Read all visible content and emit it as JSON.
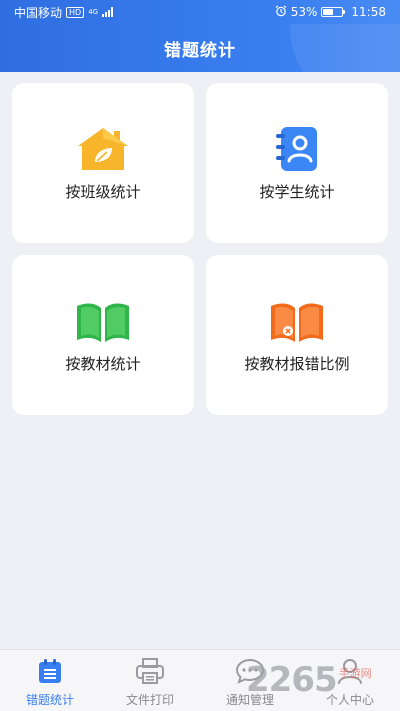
{
  "status_bar": {
    "carrier": "中国移动",
    "hd_badge": "HD",
    "network": "4G",
    "battery_percent": "53%",
    "battery_level": 0.53,
    "time": "11:58"
  },
  "header": {
    "title": "错题统计"
  },
  "cards": [
    {
      "label": "按班级统计",
      "icon": "house-leaf-icon",
      "color": "#f5a623"
    },
    {
      "label": "按学生统计",
      "icon": "contact-book-icon",
      "color": "#3a86f5"
    },
    {
      "label": "按教材统计",
      "icon": "open-book-icon",
      "color": "#2fb54a"
    },
    {
      "label": "按教材报错比例",
      "icon": "open-book-error-icon",
      "color": "#f26a1b"
    }
  ],
  "tabs": [
    {
      "label": "错题统计",
      "icon": "calendar-list-icon",
      "active": true
    },
    {
      "label": "文件打印",
      "icon": "printer-icon",
      "active": false
    },
    {
      "label": "通知管理",
      "icon": "chat-bubble-icon",
      "active": false
    },
    {
      "label": "个人中心",
      "icon": "person-icon",
      "active": false
    }
  ],
  "colors": {
    "primary": "#3a7ff0",
    "background": "#eef0f5",
    "tab_inactive": "#8a8a8e"
  },
  "watermark": {
    "number": "2265",
    "site": "手游网"
  }
}
